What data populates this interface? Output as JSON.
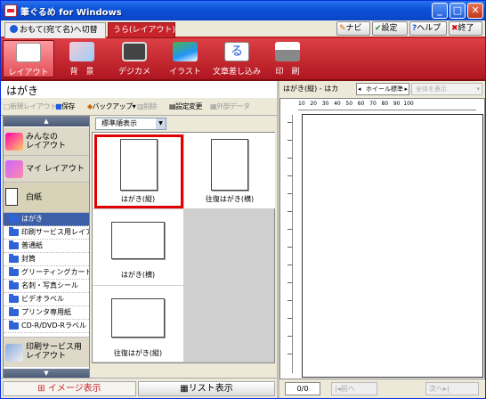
{
  "app": {
    "title": "筆ぐるめ for Windows"
  },
  "window_buttons": {
    "min": "_",
    "max": "□",
    "close": "✕"
  },
  "tabs": {
    "front": "おもて(宛て名)へ切替",
    "back": "うら(レイアウト)"
  },
  "top_buttons": {
    "navi": "ナビ",
    "settings": "設定",
    "help": "ヘルプ",
    "exit": "終了"
  },
  "modes": [
    {
      "label": "レイアウト"
    },
    {
      "label": "背　景"
    },
    {
      "label": "デジカメ"
    },
    {
      "label": "イラスト"
    },
    {
      "label": "文章差し込み"
    },
    {
      "label": "印　刷"
    }
  ],
  "panel_title": "はがき",
  "toolbar": {
    "new": "新規レイアウト",
    "save": "保存",
    "backup": "バックアップ",
    "delete": "削除",
    "settings_change": "設定変更",
    "external": "外部データ"
  },
  "right_header": {
    "label": "はがき(縦) - はカ",
    "mode": "ホイール標準",
    "view": "全体を表示"
  },
  "sort": {
    "selected": "標準順表示"
  },
  "sidebar": {
    "categories": {
      "everyone": "みんなの\nレイアウト",
      "my": "マイ レイアウト",
      "blank": "白紙",
      "print_service": "印刷サービス用\nレイアウト"
    },
    "items": [
      {
        "label": "はがき"
      },
      {
        "label": "印刷サービス用レイアウト"
      },
      {
        "label": "普通紙"
      },
      {
        "label": "封筒"
      },
      {
        "label": "グリーティングカード"
      },
      {
        "label": "名刺・写真シール"
      },
      {
        "label": "ビデオラベル"
      },
      {
        "label": "プリンタ専用紙"
      },
      {
        "label": "CD-R/DVD-Rラベル"
      }
    ]
  },
  "layouts": [
    {
      "label": "はがき(縦)",
      "orientation": "portrait"
    },
    {
      "label": "往復はがき(横)",
      "orientation": "portrait"
    },
    {
      "label": "はがき(横)",
      "orientation": "landscape"
    },
    {
      "label": "往復はがき(縦)",
      "orientation": "landscape"
    }
  ],
  "bottom": {
    "image_view": "イメージ表示",
    "list_view": "リスト表示"
  },
  "preview": {
    "ruler": "10   20   30   40   50   60   70   80   90  100",
    "page_count": "0/0",
    "prev": "前へ",
    "next": "次へ"
  },
  "colors": {
    "accent": "#c6242a",
    "title_bar": "#0a50d8",
    "selection": "#e00000"
  }
}
